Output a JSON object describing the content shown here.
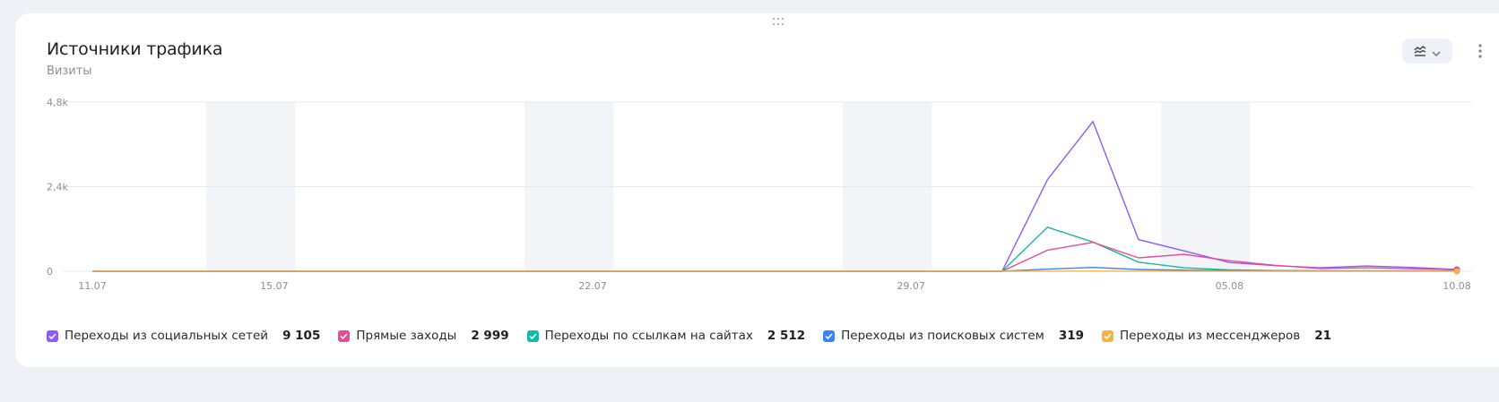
{
  "card": {
    "title": "Источники трафика",
    "subtitle": "Визиты"
  },
  "toolbar": {
    "chart_type_icon": "line-chart-icon",
    "dropdown_icon": "chevron-down-icon",
    "more_icon": "more-vertical-icon"
  },
  "colors": {
    "social": "#8b5cf6",
    "direct": "#ec4899",
    "links": "#14b8a6",
    "search": "#3b82f6",
    "messengers": "#f5b342",
    "weekend_band": "#f3f4f8",
    "grid": "#e6e8ec"
  },
  "chart_data": {
    "type": "line",
    "title": "Источники трафика",
    "ylabel": "Визиты",
    "ylim": [
      0,
      4800
    ],
    "yticks": [
      {
        "value": 0,
        "label": "0"
      },
      {
        "value": 2400,
        "label": "2,4k"
      },
      {
        "value": 4800,
        "label": "4,8k"
      }
    ],
    "x": [
      "11.07",
      "12.07",
      "13.07",
      "14.07",
      "15.07",
      "16.07",
      "17.07",
      "18.07",
      "19.07",
      "20.07",
      "21.07",
      "22.07",
      "23.07",
      "24.07",
      "25.07",
      "26.07",
      "27.07",
      "28.07",
      "29.07",
      "30.07",
      "31.07",
      "01.08",
      "02.08",
      "03.08",
      "04.08",
      "05.08",
      "06.08",
      "07.08",
      "08.08",
      "09.08",
      "10.08"
    ],
    "xticks": [
      {
        "index": 0,
        "label": "11.07"
      },
      {
        "index": 4,
        "label": "15.07"
      },
      {
        "index": 11,
        "label": "22.07"
      },
      {
        "index": 18,
        "label": "29.07"
      },
      {
        "index": 25,
        "label": "05.08"
      },
      {
        "index": 30,
        "label": "10.08"
      }
    ],
    "weekend_bands": [
      [
        2,
        4
      ],
      [
        9,
        11
      ],
      [
        16,
        18
      ],
      [
        23,
        25
      ]
    ],
    "grid": true,
    "legend_position": "bottom",
    "series": [
      {
        "key": "social",
        "name": "Переходы из социальных сетей",
        "total": "9 105",
        "values": [
          0,
          0,
          0,
          0,
          0,
          0,
          0,
          0,
          0,
          0,
          0,
          0,
          0,
          0,
          0,
          0,
          0,
          0,
          0,
          0,
          0,
          2600,
          4250,
          900,
          580,
          250,
          160,
          100,
          150,
          110,
          50
        ]
      },
      {
        "key": "direct",
        "name": "Прямые заходы",
        "total": "2 999",
        "values": [
          0,
          0,
          0,
          0,
          0,
          0,
          0,
          0,
          0,
          0,
          0,
          0,
          0,
          0,
          0,
          0,
          0,
          0,
          0,
          0,
          0,
          600,
          820,
          380,
          480,
          300,
          170,
          80,
          100,
          70,
          40
        ]
      },
      {
        "key": "links",
        "name": "Переходы по ссылкам на сайтах",
        "total": "2 512",
        "values": [
          0,
          0,
          0,
          0,
          0,
          0,
          0,
          0,
          0,
          0,
          0,
          0,
          0,
          0,
          0,
          0,
          0,
          0,
          0,
          0,
          0,
          1250,
          830,
          260,
          100,
          40,
          20,
          15,
          15,
          10,
          5
        ]
      },
      {
        "key": "search",
        "name": "Переходы из поисковых систем",
        "total": "319",
        "values": [
          0,
          0,
          0,
          0,
          0,
          0,
          0,
          0,
          0,
          0,
          0,
          0,
          0,
          0,
          0,
          0,
          0,
          0,
          0,
          0,
          0,
          60,
          110,
          50,
          30,
          20,
          15,
          10,
          10,
          8,
          5
        ]
      },
      {
        "key": "messengers",
        "name": "Переходы из мессенджеров",
        "total": "21",
        "values": [
          0,
          0,
          0,
          0,
          0,
          0,
          0,
          0,
          0,
          0,
          0,
          0,
          0,
          0,
          0,
          0,
          0,
          0,
          0,
          0,
          0,
          3,
          5,
          3,
          2,
          2,
          1,
          1,
          1,
          1,
          1
        ]
      }
    ]
  }
}
